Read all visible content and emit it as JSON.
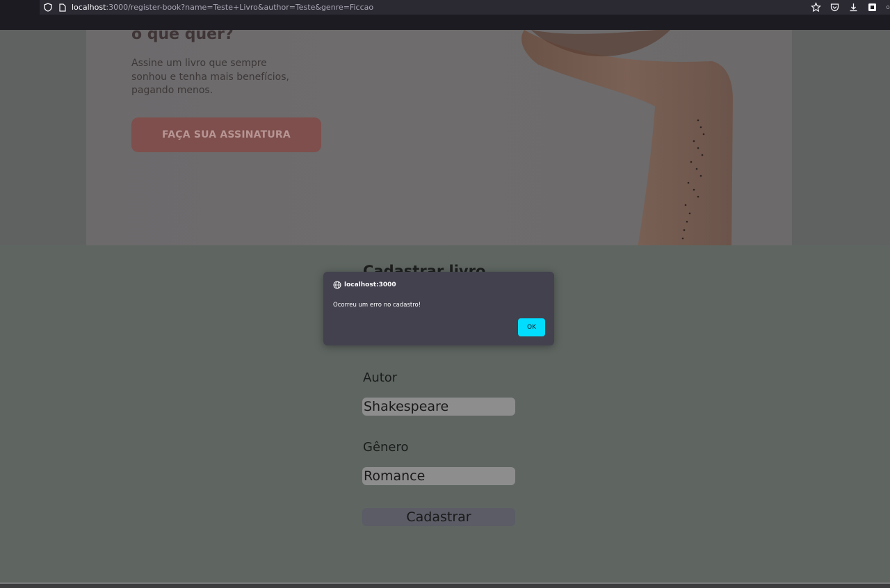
{
  "browser": {
    "url_host": "localhost",
    "url_rest": ":3000/register-book?name=Teste+Livro&author=Teste&genre=Ficcao",
    "icons": [
      "shield-icon",
      "page-icon",
      "star-icon",
      "pocket-icon",
      "download-icon",
      "extension-icon",
      "menu-icon"
    ]
  },
  "hero": {
    "title": "o que quer?",
    "subtitle": "Assine um livro que sempre sonhou e tenha mais benefícios, pagando menos.",
    "cta_label": "FAÇA SUA ASSINATURA"
  },
  "form": {
    "title": "Cadastrar livro",
    "author_label": "Autor",
    "author_value": "Shakespeare",
    "genre_label": "Gênero",
    "genre_value": "Romance",
    "submit_label": "Cadastrar"
  },
  "dialog": {
    "origin": "localhost:3000",
    "message": "Ocorreu um erro no cadastro!",
    "ok_label": "OK"
  },
  "colors": {
    "dialog_bg": "#42414d",
    "ok_button": "#00ddff",
    "cta_button": "#7e4f4c"
  }
}
